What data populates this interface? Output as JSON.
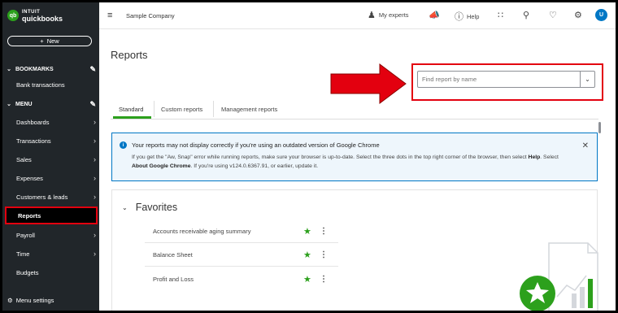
{
  "app": {
    "logo_top": "INTUIT",
    "logo_bottom": "quickbooks",
    "logo_badge": "qb"
  },
  "sidebar": {
    "new_label": "New",
    "bookmarks_label": "BOOKMARKS",
    "bookmarks_items": [
      {
        "label": "Bank transactions"
      }
    ],
    "menu_label": "MENU",
    "menu_items": [
      {
        "label": "Dashboards"
      },
      {
        "label": "Transactions"
      },
      {
        "label": "Sales"
      },
      {
        "label": "Expenses"
      },
      {
        "label": "Customers & leads"
      },
      {
        "label": "Reports",
        "active": true
      },
      {
        "label": "Payroll"
      },
      {
        "label": "Time"
      },
      {
        "label": "Budgets"
      }
    ],
    "menu_settings": "Menu settings"
  },
  "topbar": {
    "company": "Sample Company",
    "my_experts": "My experts",
    "help": "Help",
    "avatar_initial": "U",
    "icons": [
      "hamburger-icon",
      "person-icon",
      "megaphone-icon",
      "help-icon",
      "apps-grid-icon",
      "search-icon",
      "bell-icon",
      "gear-icon"
    ]
  },
  "page": {
    "title": "Reports",
    "search_placeholder": "Find report by name",
    "tabs": [
      {
        "label": "Standard",
        "active": true
      },
      {
        "label": "Custom reports"
      },
      {
        "label": "Management reports"
      }
    ]
  },
  "alert": {
    "title": "Your reports may not display correctly if you're using an outdated version of Google Chrome",
    "body_part1": "If you get the \"Aw, Snap\" error while running reports, make sure your browser is up-to-date. Select the three dots in the top right corner of the browser, then select ",
    "help_word": "Help",
    "body_part2": ". Select ",
    "about_chrome": "About Google Chrome",
    "body_part3": ". If you're using v124.0.6367.91, or earlier, update it."
  },
  "favorites": {
    "title": "Favorites",
    "items": [
      {
        "label": "Accounts receivable aging summary"
      },
      {
        "label": "Balance Sheet"
      },
      {
        "label": "Profit and Loss"
      }
    ]
  },
  "colors": {
    "brand_green": "#2ca01c",
    "sidebar_bg": "#21262a",
    "highlight_red": "#e3000f",
    "info_blue": "#0077c5"
  }
}
